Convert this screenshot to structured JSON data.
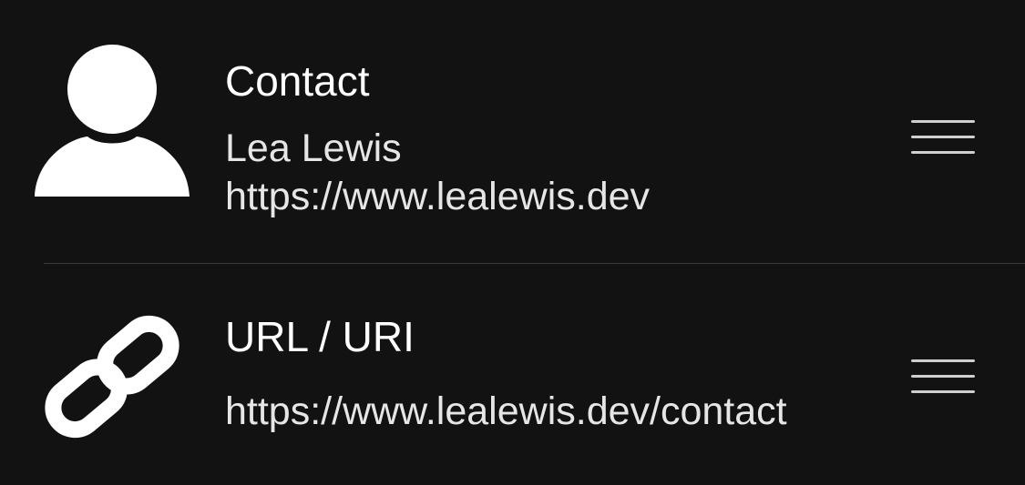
{
  "items": [
    {
      "title": "Contact",
      "lines": [
        "Lea Lewis",
        "https://www.lealewis.dev"
      ],
      "icon": "person-icon"
    },
    {
      "title": "URL / URI",
      "lines": [
        "https://www.lealewis.dev/contact"
      ],
      "icon": "link-icon"
    }
  ],
  "colors": {
    "background": "#121212",
    "text": "#ffffff",
    "divider": "#3a3a3a"
  }
}
